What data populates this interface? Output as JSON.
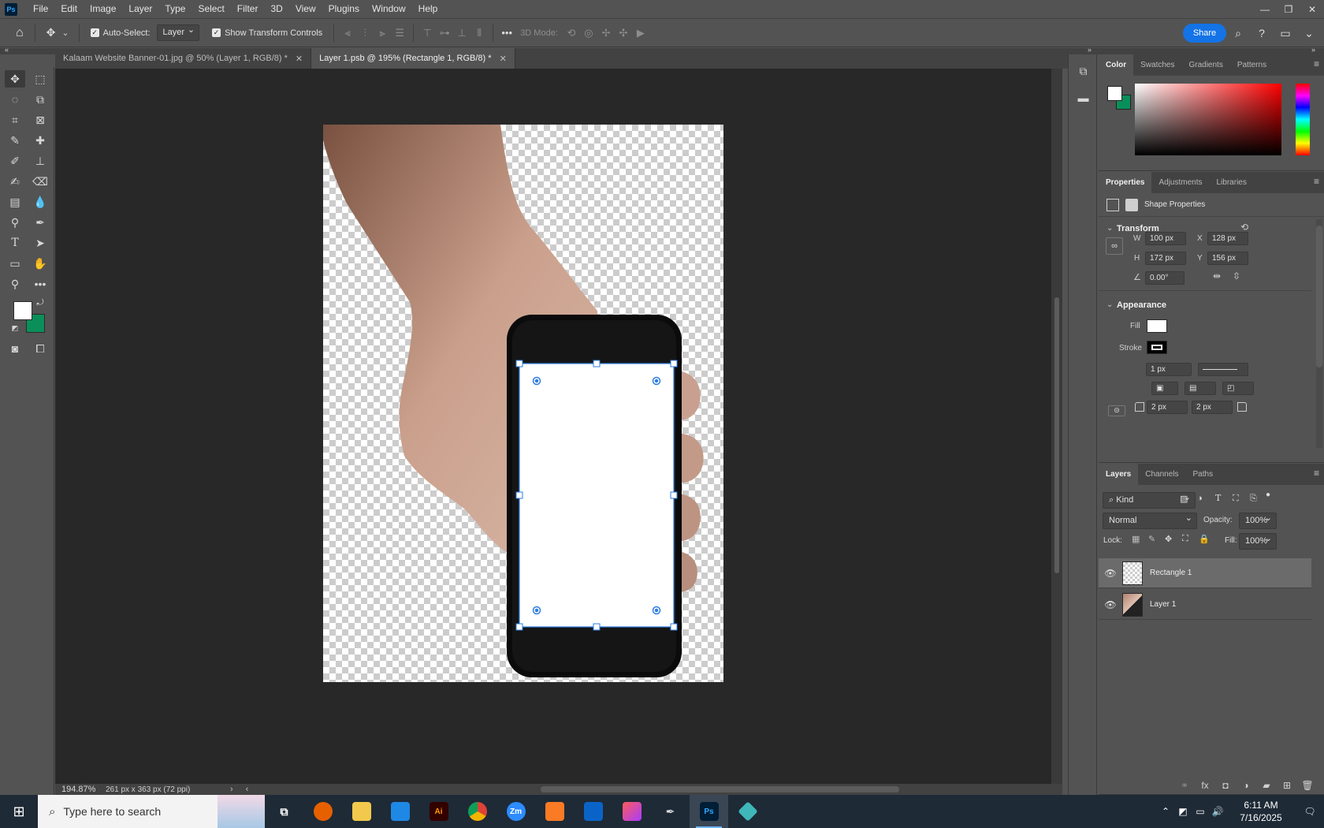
{
  "app": {
    "logo": "Ps",
    "menu": [
      "File",
      "Edit",
      "Image",
      "Layer",
      "Type",
      "Select",
      "Filter",
      "3D",
      "View",
      "Plugins",
      "Window",
      "Help"
    ]
  },
  "options": {
    "auto_select_label": "Auto-Select:",
    "auto_select_value": "Layer",
    "show_transform_label": "Show Transform Controls",
    "mode3d_label": "3D Mode:",
    "share_label": "Share"
  },
  "tabs": [
    {
      "label": "Kalaam Website Banner-01.jpg @ 50% (Layer 1, RGB/8) *"
    },
    {
      "label": "Layer 1.psb @ 195% (Rectangle 1, RGB/8) *"
    }
  ],
  "status": {
    "zoom": "194.87%",
    "doc_info": "261 px x 363 px (72 ppi)"
  },
  "color_panel": {
    "tabs": [
      "Color",
      "Swatches",
      "Gradients",
      "Patterns"
    ],
    "fg": "#ffffff",
    "bg": "#0a8f5a"
  },
  "properties": {
    "tabs": [
      "Properties",
      "Adjustments",
      "Libraries"
    ],
    "header": "Shape Properties",
    "transform_title": "Transform",
    "w_label": "W",
    "w": "100 px",
    "x_label": "X",
    "x": "128 px",
    "h_label": "H",
    "h": "172 px",
    "y_label": "Y",
    "y": "156 px",
    "angle": "0.00°",
    "appearance_title": "Appearance",
    "fill_label": "Fill",
    "stroke_label": "Stroke",
    "stroke_width": "1 px",
    "radius_a": "2 px",
    "radius_b": "2 px"
  },
  "layers_panel": {
    "tabs": [
      "Layers",
      "Channels",
      "Paths"
    ],
    "kind_label": "Kind",
    "blend_mode": "Normal",
    "opacity_label": "Opacity:",
    "opacity": "100%",
    "lock_label": "Lock:",
    "fill_label": "Fill:",
    "fill": "100%",
    "layers": [
      {
        "name": "Rectangle 1"
      },
      {
        "name": "Layer 1"
      }
    ]
  },
  "taskbar": {
    "search_placeholder": "Type here to search",
    "apps": [
      "Ai",
      "Zm",
      "Ps"
    ],
    "time": "6:11 AM",
    "date": "7/16/2025"
  }
}
